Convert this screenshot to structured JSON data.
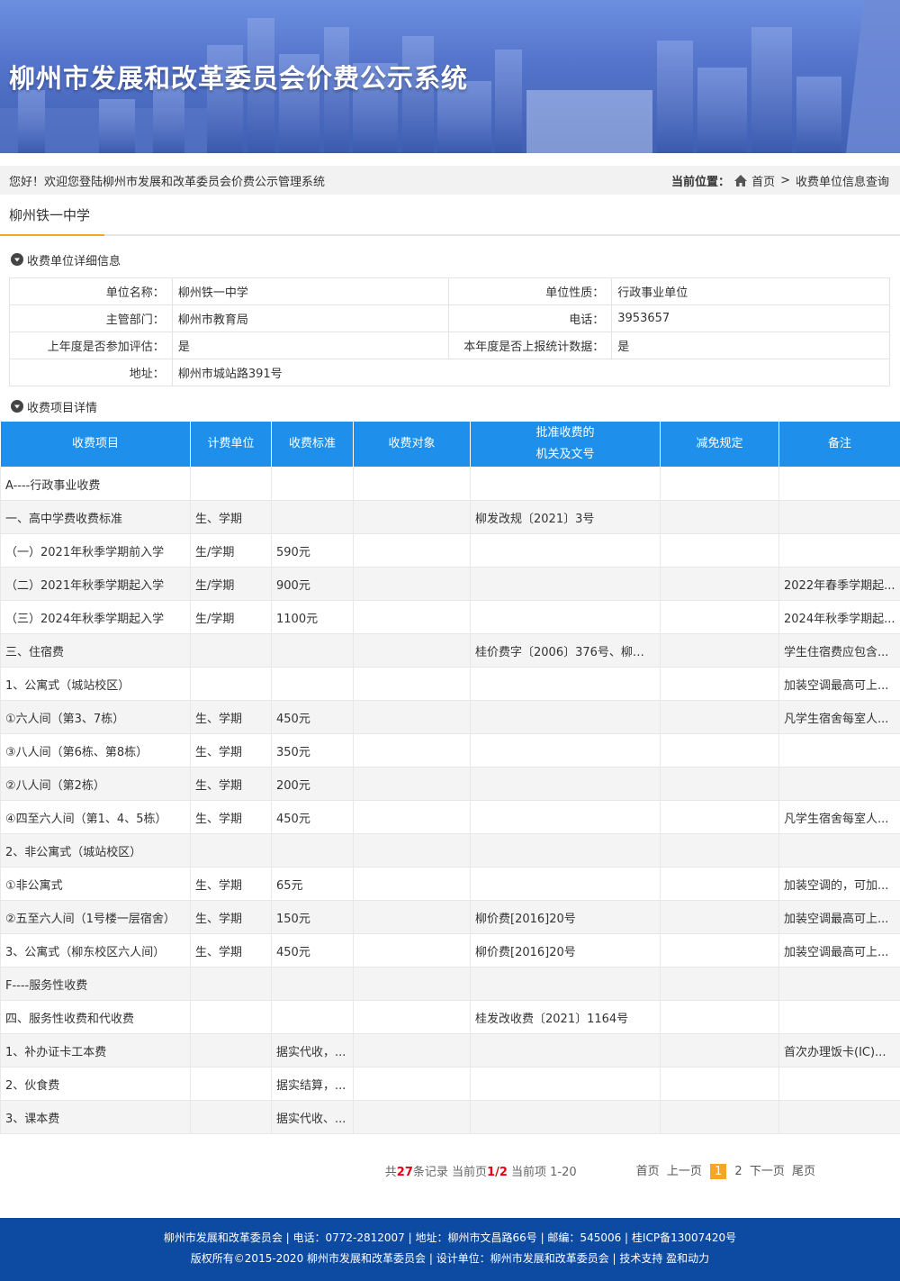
{
  "banner": {
    "title": "柳州市发展和改革委员会价费公示系统"
  },
  "welcome": {
    "text": "您好！欢迎您登陆柳州市发展和改革委员会价费公示管理系统",
    "location_label": "当前位置：",
    "home": "首页",
    "separator": ">",
    "current": "收费单位信息查询"
  },
  "tab": {
    "label": "柳州铁一中学"
  },
  "sections": {
    "unit_info": "收费单位详细信息",
    "items": "收费项目详情"
  },
  "unit": {
    "name_label": "单位名称：",
    "name": "柳州铁一中学",
    "nature_label": "单位性质：",
    "nature": "行政事业单位",
    "dept_label": "主管部门：",
    "dept": "柳州市教育局",
    "phone_label": "电话：",
    "phone": "3953657",
    "eval_label": "上年度是否参加评估：",
    "eval": "是",
    "report_label": "本年度是否上报统计数据：",
    "report": "是",
    "addr_label": "地址：",
    "addr": "柳州市城站路391号"
  },
  "table": {
    "headers": {
      "item": "收费项目",
      "unit": "计费单位",
      "standard": "收费标准",
      "target": "收费对象",
      "doc_line1": "批准收费的",
      "doc_line2": "机关及文号",
      "reduce": "减免规定",
      "note": "备注"
    },
    "rows": [
      {
        "item": "A----行政事业收费",
        "unit": "",
        "standard": "",
        "target": "",
        "doc": "",
        "reduce": "",
        "note": ""
      },
      {
        "item": "一、高中学费收费标准",
        "unit": "生、学期",
        "standard": "",
        "target": "",
        "doc": "柳发改规〔2021〕3号",
        "reduce": "",
        "note": ""
      },
      {
        "item": "（一）2021年秋季学期前入学",
        "unit": "生/学期",
        "standard": "590元",
        "target": "",
        "doc": "",
        "reduce": "",
        "note": ""
      },
      {
        "item": "（二）2021年秋季学期起入学",
        "unit": "生/学期",
        "standard": "900元",
        "target": "",
        "doc": "",
        "reduce": "",
        "note": "2022年春季学期起..."
      },
      {
        "item": "（三）2024年秋季学期起入学",
        "unit": "生/学期",
        "standard": "1100元",
        "target": "",
        "doc": "",
        "reduce": "",
        "note": "2024年秋季学期起..."
      },
      {
        "item": "三、住宿费",
        "unit": "",
        "standard": "",
        "target": "",
        "doc": "桂价费字〔2006〕376号、柳价...",
        "reduce": "",
        "note": "学生住宿费应包含..."
      },
      {
        "item": "1、公寓式（城站校区）",
        "unit": "",
        "standard": "",
        "target": "",
        "doc": "",
        "reduce": "",
        "note": "加装空调最高可上..."
      },
      {
        "item": "①六人间（第3、7栋）",
        "unit": "生、学期",
        "standard": "450元",
        "target": "",
        "doc": "",
        "reduce": "",
        "note": "凡学生宿舍每室人..."
      },
      {
        "item": "③八人间（第6栋、第8栋）",
        "unit": "生、学期",
        "standard": "350元",
        "target": "",
        "doc": "",
        "reduce": "",
        "note": ""
      },
      {
        "item": "②八人间（第2栋）",
        "unit": "生、学期",
        "standard": "200元",
        "target": "",
        "doc": "",
        "reduce": "",
        "note": ""
      },
      {
        "item": "④四至六人间（第1、4、5栋）",
        "unit": "生、学期",
        "standard": "450元",
        "target": "",
        "doc": "",
        "reduce": "",
        "note": "凡学生宿舍每室人..."
      },
      {
        "item": "2、非公寓式（城站校区）",
        "unit": "",
        "standard": "",
        "target": "",
        "doc": "",
        "reduce": "",
        "note": ""
      },
      {
        "item": "①非公寓式",
        "unit": "生、学期",
        "standard": "65元",
        "target": "",
        "doc": "",
        "reduce": "",
        "note": "加装空调的，可加..."
      },
      {
        "item": "②五至六人间（1号楼一层宿舍）",
        "unit": "生、学期",
        "standard": "150元",
        "target": "",
        "doc": "柳价费[2016]20号",
        "reduce": "",
        "note": "加装空调最高可上..."
      },
      {
        "item": "3、公寓式（柳东校区六人间）",
        "unit": "生、学期",
        "standard": "450元",
        "target": "",
        "doc": "柳价费[2016]20号",
        "reduce": "",
        "note": "加装空调最高可上..."
      },
      {
        "item": "F----服务性收费",
        "unit": "",
        "standard": "",
        "target": "",
        "doc": "",
        "reduce": "",
        "note": ""
      },
      {
        "item": "四、服务性收费和代收费",
        "unit": "",
        "standard": "",
        "target": "",
        "doc": "桂发改收费〔2021〕1164号",
        "reduce": "",
        "note": ""
      },
      {
        "item": "1、补办证卡工本费",
        "unit": "",
        "standard": "据实代收，...",
        "target": "",
        "doc": "",
        "reduce": "",
        "note": "首次办理饭卡(IC)..."
      },
      {
        "item": "2、伙食费",
        "unit": "",
        "standard": "据实结算，...",
        "target": "",
        "doc": "",
        "reduce": "",
        "note": ""
      },
      {
        "item": "3、课本费",
        "unit": "",
        "standard": "据实代收、...",
        "target": "",
        "doc": "",
        "reduce": "",
        "note": ""
      }
    ]
  },
  "pager": {
    "prefix": "共",
    "total": "27",
    "suffix": "条记录",
    "page_label": "当前页",
    "page": "1/2",
    "range": "当前项 1-20",
    "first": "首页",
    "prev": "上一页",
    "p1": "1",
    "p2": "2",
    "next": "下一页",
    "last": "尾页",
    "accent": "#f5a623",
    "highlight": "#e60012"
  },
  "footer": {
    "line1": "柳州市发展和改革委员会 | 电话：0772-2812007 | 地址：柳州市文昌路66号 | 邮编：545006 | 桂ICP备13007420号",
    "line2": "版权所有©2015-2020 柳州市发展和改革委员会 | 设计单位：柳州市发展和改革委员会 | 技术支持 盈和动力",
    "bg": "#0d4aa2"
  },
  "colors": {
    "header_bg": "#1e90ec",
    "tab_underline": "#f5a623"
  }
}
